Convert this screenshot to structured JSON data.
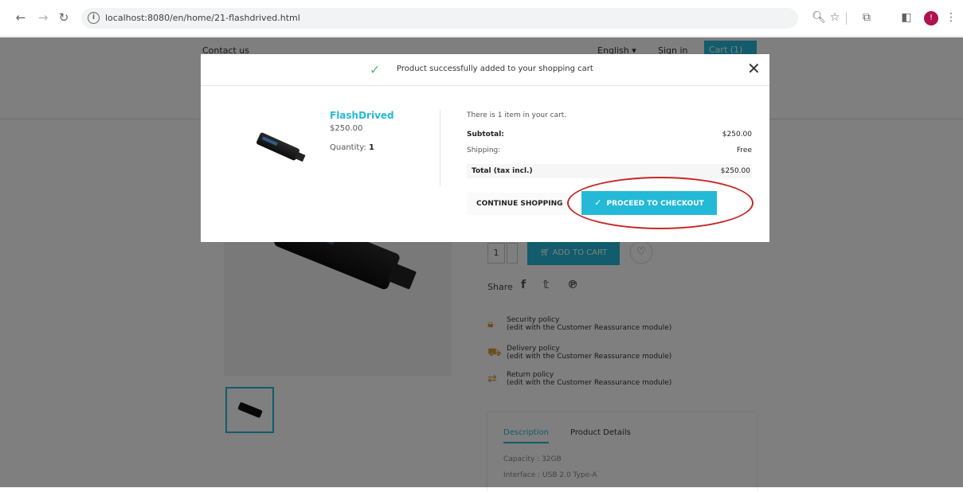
{
  "browser": {
    "url": "localhost:8080/en/home/21-flashdrived.html",
    "profile_initial": "!"
  },
  "header": {
    "contact": "Contact us",
    "language": "English ▾",
    "sign_in": "Sign in",
    "cart": "Cart (1)"
  },
  "product_page": {
    "qty_value": "1",
    "add_to_cart": "ADD TO CART",
    "share_label": "Share",
    "policies": [
      {
        "title": "Security policy",
        "desc": "(edit with the Customer Reassurance module)"
      },
      {
        "title": "Delivery policy",
        "desc": "(edit with the Customer Reassurance module)"
      },
      {
        "title": "Return policy",
        "desc": "(edit with the Customer Reassurance module)"
      }
    ],
    "tabs": {
      "description": "Description",
      "details": "Product Details"
    },
    "specs": [
      "Capacity : 32GB",
      "Interface : USB 2.0 Type-A"
    ]
  },
  "modal": {
    "success_message": "Product successfully added to your shopping cart",
    "close": "✕",
    "product_name": "FlashDrived",
    "product_price": "$250.00",
    "quantity_label": "Quantity:",
    "quantity_value": "1",
    "cart_info": "There is 1 item in your cart.",
    "subtotal_label": "Subtotal:",
    "subtotal_value": "$250.00",
    "shipping_label": "Shipping:",
    "shipping_value": "Free",
    "total_label": "Total (tax incl.)",
    "total_value": "$250.00",
    "continue_label": "CONTINUE SHOPPING",
    "checkout_label": "PROCEED TO CHECKOUT"
  },
  "colors": {
    "accent": "#24b9d7",
    "success": "#4cbb6c",
    "annotation_ring": "#c62828"
  }
}
